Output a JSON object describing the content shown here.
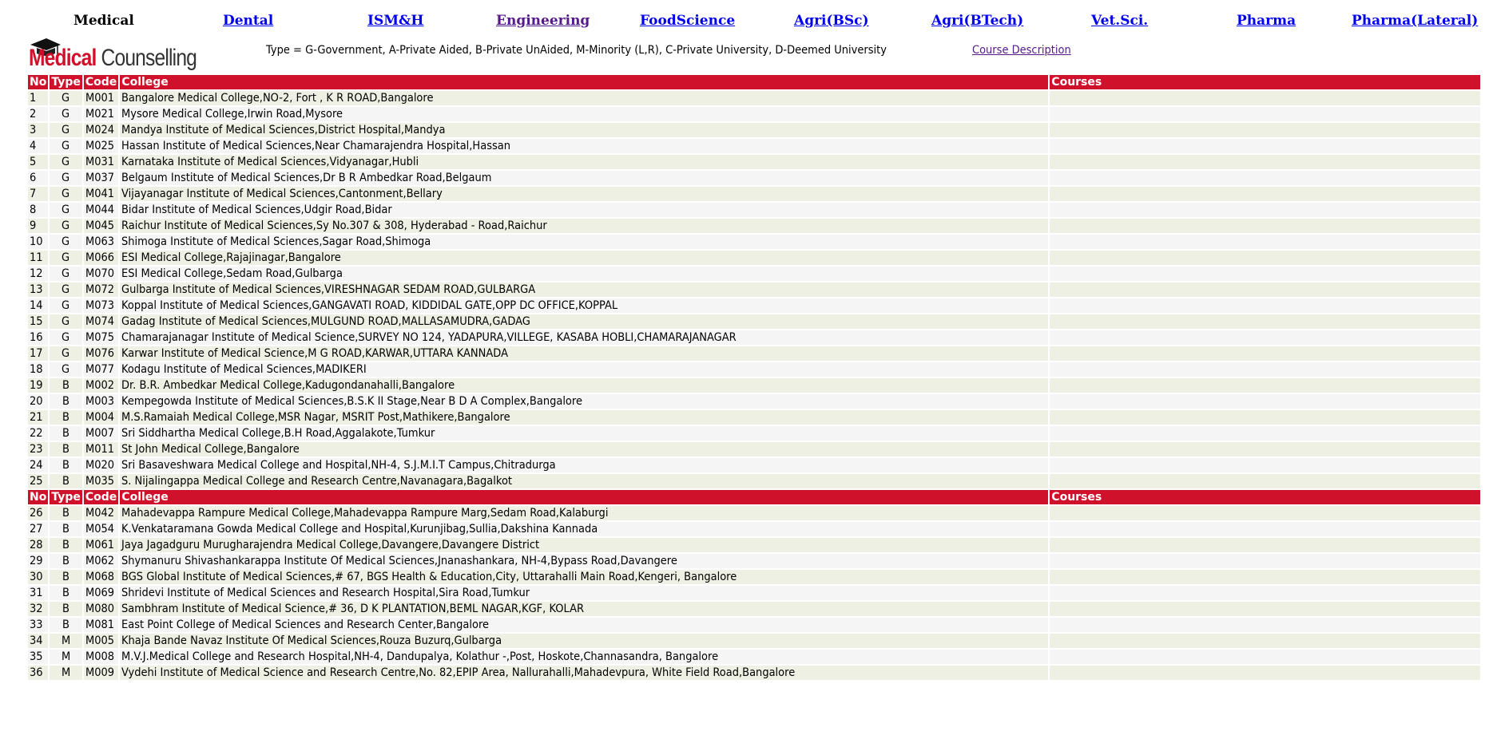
{
  "nav": {
    "current": "Medical",
    "links": [
      "Dental",
      "ISM&H",
      "Engineering",
      "FoodScience",
      "Agri(BSc)",
      "Agri(BTech)",
      "Vet.Sci.",
      "Pharma",
      "Pharma(Lateral)"
    ]
  },
  "logo": {
    "red": "Medical",
    "dark": " Counselling"
  },
  "legend": "Type = G-Government, A-Private Aided, B-Private UnAided, M-Minority (L,R), C-Private University, D-Deemed University",
  "course_description": "Course Description",
  "headers": {
    "no": "No",
    "type": "Type",
    "code": "Code",
    "college": "College",
    "courses": "Courses"
  },
  "group1": [
    {
      "no": "1",
      "type": "G",
      "code": "M001",
      "college": "Bangalore Medical College,NO-2, Fort , K R ROAD,Bangalore"
    },
    {
      "no": "2",
      "type": "G",
      "code": "M021",
      "college": "Mysore Medical College,Irwin Road,Mysore"
    },
    {
      "no": "3",
      "type": "G",
      "code": "M024",
      "college": "Mandya Institute of Medical Sciences,District Hospital,Mandya"
    },
    {
      "no": "4",
      "type": "G",
      "code": "M025",
      "college": "Hassan Institute of Medical Sciences,Near Chamarajendra Hospital,Hassan"
    },
    {
      "no": "5",
      "type": "G",
      "code": "M031",
      "college": "Karnataka Institute of Medical Sciences,Vidyanagar,Hubli"
    },
    {
      "no": "6",
      "type": "G",
      "code": "M037",
      "college": "Belgaum Institute of Medical Sciences,Dr B R Ambedkar Road,Belgaum"
    },
    {
      "no": "7",
      "type": "G",
      "code": "M041",
      "college": "Vijayanagar Institute of Medical Sciences,Cantonment,Bellary"
    },
    {
      "no": "8",
      "type": "G",
      "code": "M044",
      "college": "Bidar Institute of Medical Sciences,Udgir Road,Bidar"
    },
    {
      "no": "9",
      "type": "G",
      "code": "M045",
      "college": "Raichur Institute of Medical Sciences,Sy No.307 & 308, Hyderabad - Road,Raichur"
    },
    {
      "no": "10",
      "type": "G",
      "code": "M063",
      "college": "Shimoga Institute of Medical Sciences,Sagar Road,Shimoga"
    },
    {
      "no": "11",
      "type": "G",
      "code": "M066",
      "college": "ESI Medical College,Rajajinagar,Bangalore"
    },
    {
      "no": "12",
      "type": "G",
      "code": "M070",
      "college": "ESI Medical College,Sedam Road,Gulbarga"
    },
    {
      "no": "13",
      "type": "G",
      "code": "M072",
      "college": "Gulbarga Institute of Medical Sciences,VIRESHNAGAR SEDAM ROAD,GULBARGA"
    },
    {
      "no": "14",
      "type": "G",
      "code": "M073",
      "college": "Koppal Institute of Medical Sciences,GANGAVATI ROAD, KIDDIDAL GATE,OPP DC OFFICE,KOPPAL"
    },
    {
      "no": "15",
      "type": "G",
      "code": "M074",
      "college": "Gadag Institute of Medical Sciences,MULGUND ROAD,MALLASAMUDRA,GADAG"
    },
    {
      "no": "16",
      "type": "G",
      "code": "M075",
      "college": "Chamarajanagar Institute of Medical Science,SURVEY NO 124, YADAPURA,VILLEGE, KASABA HOBLI,CHAMARAJANAGAR"
    },
    {
      "no": "17",
      "type": "G",
      "code": "M076",
      "college": "Karwar Institute of Medical Science,M G ROAD,KARWAR,UTTARA KANNADA"
    },
    {
      "no": "18",
      "type": "G",
      "code": "M077",
      "college": "Kodagu Institute of Medical Sciences,MADIKERI"
    },
    {
      "no": "19",
      "type": "B",
      "code": "M002",
      "college": "Dr. B.R. Ambedkar Medical College,Kadugondanahalli,Bangalore"
    },
    {
      "no": "20",
      "type": "B",
      "code": "M003",
      "college": "Kempegowda Institute of Medical Sciences,B.S.K II Stage,Near B D A Complex,Bangalore"
    },
    {
      "no": "21",
      "type": "B",
      "code": "M004",
      "college": "M.S.Ramaiah Medical College,MSR Nagar, MSRIT Post,Mathikere,Bangalore"
    },
    {
      "no": "22",
      "type": "B",
      "code": "M007",
      "college": "Sri Siddhartha Medical College,B.H Road,Aggalakote,Tumkur"
    },
    {
      "no": "23",
      "type": "B",
      "code": "M011",
      "college": "St John Medical College,Bangalore"
    },
    {
      "no": "24",
      "type": "B",
      "code": "M020",
      "college": "Sri Basaveshwara Medical College and Hospital,NH-4, S.J.M.I.T Campus,Chitradurga"
    },
    {
      "no": "25",
      "type": "B",
      "code": "M035",
      "college": "S. Nijalingappa Medical College and Research Centre,Navanagara,Bagalkot"
    }
  ],
  "group2": [
    {
      "no": "26",
      "type": "B",
      "code": "M042",
      "college": "Mahadevappa Rampure Medical College,Mahadevappa Rampure Marg,Sedam Road,Kalaburgi"
    },
    {
      "no": "27",
      "type": "B",
      "code": "M054",
      "college": "K.Venkataramana Gowda Medical College and Hospital,Kurunjibag,Sullia,Dakshina Kannada"
    },
    {
      "no": "28",
      "type": "B",
      "code": "M061",
      "college": "Jaya Jagadguru Murugharajendra Medical College,Davangere,Davangere District"
    },
    {
      "no": "29",
      "type": "B",
      "code": "M062",
      "college": "Shymanuru Shivashankarappa Institute Of Medical Sciences,Jnanashankara, NH-4,Bypass Road,Davangere"
    },
    {
      "no": "30",
      "type": "B",
      "code": "M068",
      "college": "BGS Global Institute of Medical Sciences,# 67, BGS Health & Education,City, Uttarahalli Main Road,Kengeri, Bangalore"
    },
    {
      "no": "31",
      "type": "B",
      "code": "M069",
      "college": "Shridevi Institute of Medical Sciences and Research Hospital,Sira Road,Tumkur"
    },
    {
      "no": "32",
      "type": "B",
      "code": "M080",
      "college": "Sambhram Institute of Medical Science,# 36, D K PLANTATION,BEML NAGAR,KGF, KOLAR"
    },
    {
      "no": "33",
      "type": "B",
      "code": "M081",
      "college": "East Point College of Medical Sciences and Research Center,Bangalore"
    },
    {
      "no": "34",
      "type": "M",
      "code": "M005",
      "college": "Khaja Bande Navaz Institute Of Medical Sciences,Rouza Buzurq,Gulbarga"
    },
    {
      "no": "35",
      "type": "M",
      "code": "M008",
      "college": "M.V.J.Medical College and Research Hospital,NH-4, Dandupalya, Kolathur -,Post, Hoskote,Channasandra, Bangalore"
    },
    {
      "no": "36",
      "type": "M",
      "code": "M009",
      "college": "Vydehi Institute of Medical Science and Research Centre,No. 82,EPIP Area, Nallurahalli,Mahadevpura, White Field Road,Bangalore"
    }
  ]
}
